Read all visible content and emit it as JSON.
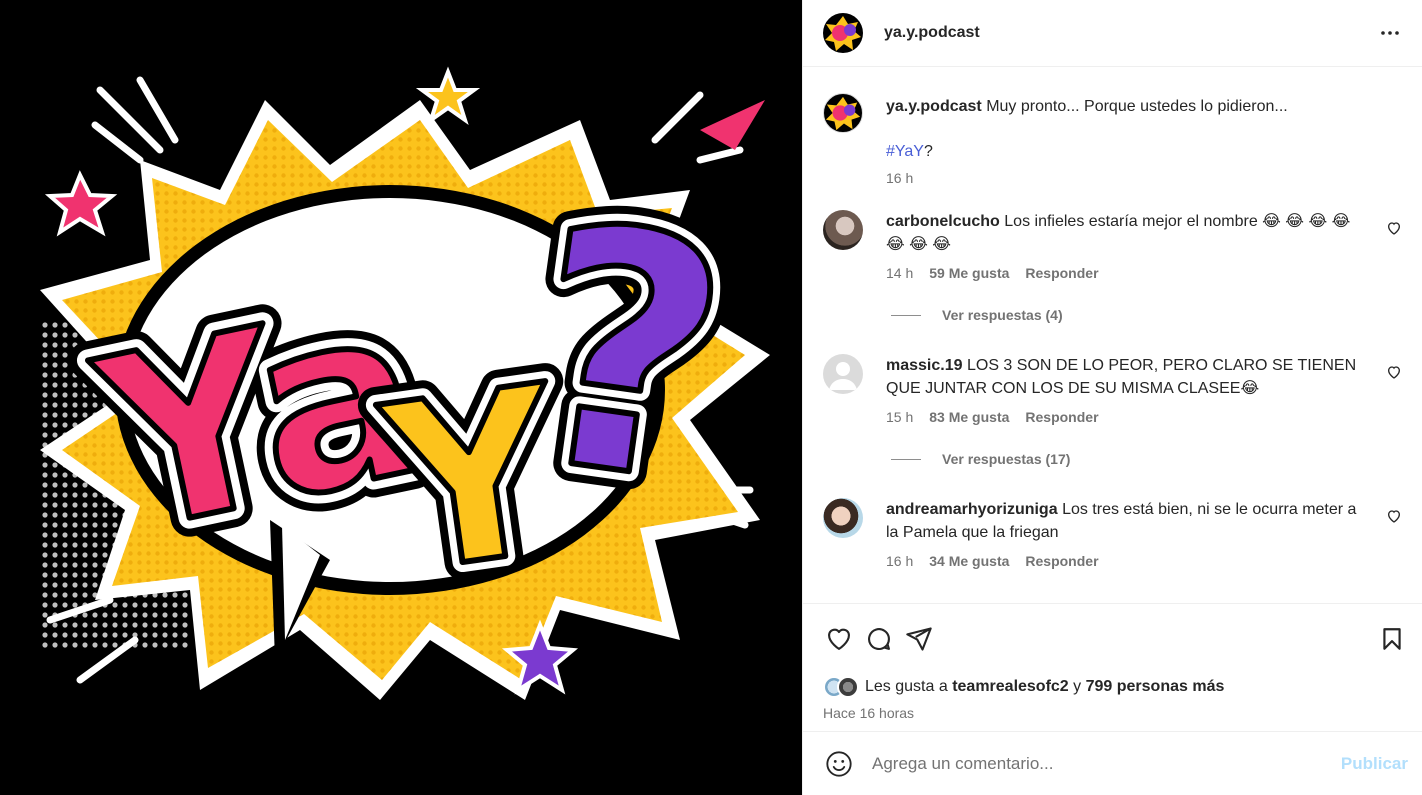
{
  "post": {
    "username": "ya.y.podcast",
    "caption": "Muy pronto... Porque ustedes lo pidieron...",
    "hashtag": "#YaY",
    "hashtag_suffix": "?",
    "time": "16 h",
    "image_logo": {
      "part1": "Ya",
      "part2": "Y",
      "part3": "?"
    }
  },
  "comments": [
    {
      "username": "carbonelcucho",
      "text": "Los infieles estaría mejor el nombre 😂 😂 😂 😂 😂 😂 😂",
      "time": "14 h",
      "likes": "59 Me gusta",
      "reply": "Responder",
      "view_replies": "Ver respuestas (4)"
    },
    {
      "username": "massic.19",
      "text": "LOS 3 SON DE LO PEOR, PERO CLARO SE TIENEN QUE JUNTAR CON LOS DE SU MISMA CLASEE😂",
      "time": "15 h",
      "likes": "83 Me gusta",
      "reply": "Responder",
      "view_replies": "Ver respuestas (17)"
    },
    {
      "username": "andreamarhyorizuniga",
      "text": "Los tres está bien, ni se le ocurra meter a la Pamela que la friegan",
      "time": "16 h",
      "likes": "34 Me gusta",
      "reply": "Responder"
    }
  ],
  "likes": {
    "prefix": "Les gusta a",
    "user": "teamrealesofc2",
    "connector": "y",
    "others": "799 personas más"
  },
  "posted_ago": "Hace 16 horas",
  "add_comment": {
    "placeholder": "Agrega un comentario...",
    "publish": "Publicar"
  },
  "colors": {
    "pink": "#f0336f",
    "yellow": "#fcc31c",
    "purple": "#7b3ad0",
    "link": "#4a5fd6",
    "publish_disabled": "#b2dffc"
  },
  "icons": [
    "more-icon",
    "heart-icon",
    "comment-icon",
    "share-icon",
    "bookmark-icon",
    "emoji-icon"
  ]
}
